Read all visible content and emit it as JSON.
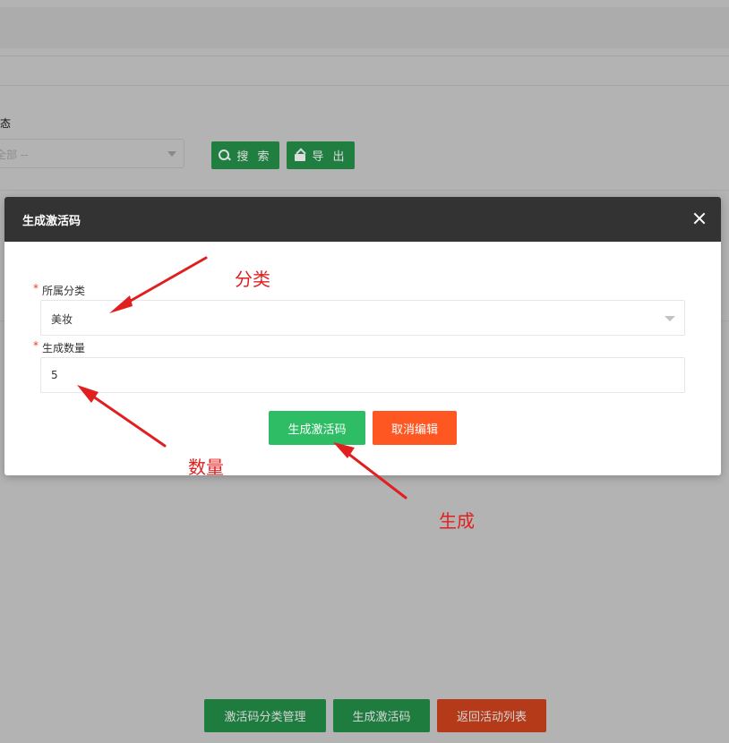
{
  "background": {
    "status_label": "状态",
    "status_select_value": "全部 --",
    "search_button": "搜 索",
    "export_button": "导 出",
    "bottom_buttons": [
      {
        "label": "激活码分类管理",
        "color": "#1e7c3f"
      },
      {
        "label": "生成激活码",
        "color": "#1e7c3f"
      },
      {
        "label": "返回活动列表",
        "color": "#b53a19"
      }
    ]
  },
  "modal": {
    "title": "生成激活码",
    "fields": [
      {
        "label": "所属分类",
        "required": "*",
        "value": "美妆",
        "type": "select"
      },
      {
        "label": "生成数量",
        "required": "*",
        "value": "5",
        "type": "input"
      }
    ],
    "generate_button": "生成激活码",
    "cancel_button": "取消编辑",
    "colors": {
      "header": "#333333",
      "primary": "#2ebd64",
      "danger": "#ff5722"
    }
  },
  "annotations": [
    {
      "text": "分类"
    },
    {
      "text": "数量"
    },
    {
      "text": "生成"
    }
  ],
  "annotation_color": "#e02020"
}
